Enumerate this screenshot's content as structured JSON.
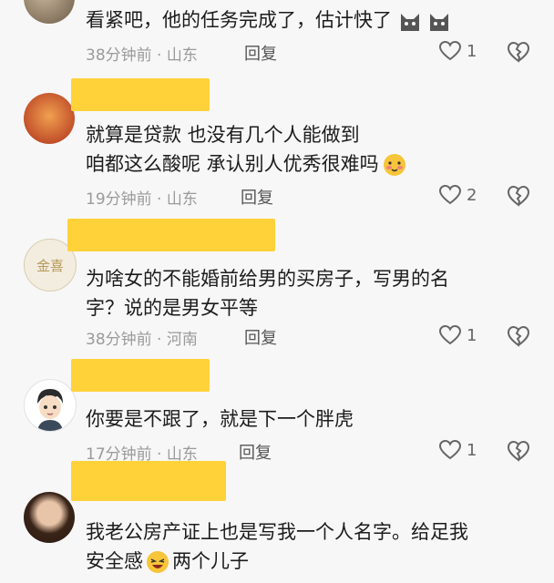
{
  "comments": [
    {
      "text_lines": [
        "看紧吧，他的任务完成了，估计快了"
      ],
      "time": "38分钟前",
      "location": "山东",
      "reply_label": "回复",
      "likes": "1"
    },
    {
      "text_lines": [
        "就算是贷款 也没有几个人能做到",
        "咱都这么酸呢 承认别人优秀很难吗"
      ],
      "time": "19分钟前",
      "location": "山东",
      "reply_label": "回复",
      "likes": "2"
    },
    {
      "text_lines": [
        "为啥女的不能婚前给男的买房子，写男的名",
        "字？说的是男女平等"
      ],
      "time": "38分钟前",
      "location": "河南",
      "reply_label": "回复",
      "likes": "1"
    },
    {
      "text_lines": [
        "你要是不跟了，就是下一个胖虎"
      ],
      "time": "17分钟前",
      "location": "山东",
      "reply_label": "回复",
      "likes": "1"
    },
    {
      "text_lines": [
        "我老公房产证上也是写我一个人名字。给足我",
        "安全感",
        "两个儿子"
      ],
      "time": "",
      "location": "",
      "reply_label": "",
      "likes": ""
    }
  ],
  "separator": "·",
  "avatar3_text": "金喜",
  "colors": {
    "redaction": "#ffd23a",
    "meta": "#9a9a9a"
  }
}
